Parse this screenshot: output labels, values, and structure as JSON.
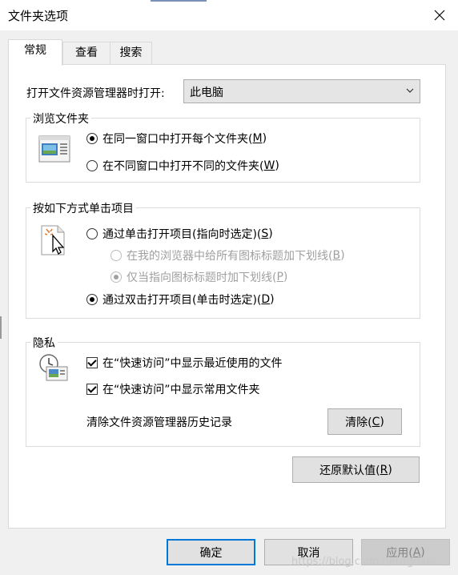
{
  "window": {
    "title": "文件夹选项"
  },
  "tabs": [
    "常规",
    "查看",
    "搜索"
  ],
  "open_explorer": {
    "label": "打开文件资源管理器时打开:",
    "value": "此电脑"
  },
  "browse_folders": {
    "title": "浏览文件夹",
    "same_window": {
      "text": "在同一窗口中打开每个文件夹(",
      "key": "M",
      "end": ")"
    },
    "new_window": {
      "text": "在不同窗口中打开不同的文件夹(",
      "key": "W",
      "end": ")"
    }
  },
  "click_items": {
    "title": "按如下方式单击项目",
    "single_click": {
      "text": "通过单击打开项目(指向时选定)(",
      "key": "S",
      "end": ")"
    },
    "underline_all": {
      "text": "在我的浏览器中给所有图标标题加下划线(",
      "key": "B",
      "end": ")"
    },
    "underline_point": {
      "text": "仅当指向图标标题时加下划线(",
      "key": "P",
      "end": ")"
    },
    "double_click": {
      "text": "通过双击打开项目(单击时选定)(",
      "key": "D",
      "end": ")"
    }
  },
  "privacy": {
    "title": "隐私",
    "recent_files": "在“快速访问”中显示最近使用的文件",
    "frequent_folders": "在“快速访问”中显示常用文件夹",
    "clear_label": "清除文件资源管理器历史记录",
    "clear_button": {
      "text": "清除(",
      "key": "C",
      "end": ")"
    }
  },
  "restore_button": {
    "text": "还原默认值(",
    "key": "R",
    "end": ")"
  },
  "footer": {
    "ok": "确定",
    "cancel": "取消",
    "apply": {
      "text": "应用(",
      "key": "A",
      "end": ")"
    }
  },
  "watermark": "https://blog.csdn.net/tgdabc",
  "colors": {
    "accent": "#0078d7",
    "panel": "#ffffff",
    "chrome": "#f0f0f0"
  },
  "icons": [
    "close-icon",
    "chevron-down-icon",
    "folder-window-icon",
    "pointer-click-icon",
    "privacy-clock-icon"
  ]
}
